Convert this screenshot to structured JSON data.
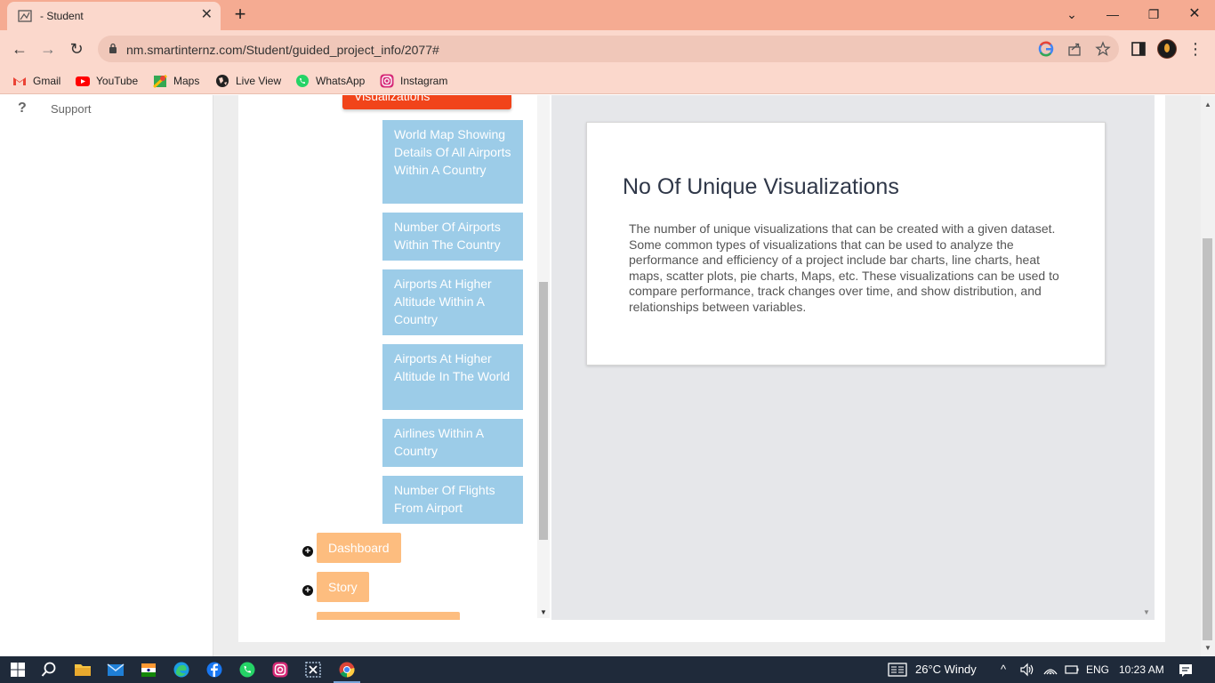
{
  "browser": {
    "tab_title": "- Student",
    "tab_close": "✕",
    "new_tab": "+",
    "url": "nm.smartinternz.com/Student/guided_project_info/2077#",
    "window_controls": {
      "minimize": "—",
      "restore": "❐",
      "close": "✕",
      "dropdown": "⌄"
    },
    "nav": {
      "back": "←",
      "forward": "→",
      "reload": "↻"
    },
    "toolbar_icons": [
      "google-icon",
      "share-icon",
      "star-icon",
      "side-panel-icon",
      "profile-avatar",
      "more-menu-icon"
    ],
    "more_menu": "⋮"
  },
  "bookmarks": [
    {
      "label": "Gmail",
      "icon": "gmail-icon",
      "color": "#ea4335"
    },
    {
      "label": "YouTube",
      "icon": "youtube-icon",
      "color": "#ff0000"
    },
    {
      "label": "Maps",
      "icon": "maps-icon",
      "color": "#34a853"
    },
    {
      "label": "Live View",
      "icon": "globe-icon",
      "color": "#222222"
    },
    {
      "label": "WhatsApp",
      "icon": "whatsapp-icon",
      "color": "#25d366"
    },
    {
      "label": "Instagram",
      "icon": "instagram-icon",
      "color": "#d62976"
    }
  ],
  "sidebar": {
    "support_icon": "?",
    "support_label": "Support"
  },
  "tree": {
    "active_item": "Visualizations",
    "sub_items": [
      "World Map Showing Details Of All Airports Within A Country",
      "Number Of Airports Within The Country",
      "Airports At Higher Altitude Within A Country",
      "Airports At Higher Altitude In The World",
      "Airlines Within A Country",
      "Number Of Flights From Airport"
    ],
    "sections": [
      {
        "label": "Dashboard"
      },
      {
        "label": "Story"
      }
    ],
    "plus_symbol": "+",
    "scroll_down": "▼",
    "colors": {
      "active": "#f1441a",
      "sub_item": "#9ccce8",
      "section": "#fdbd7f"
    }
  },
  "content": {
    "title": "No Of Unique Visualizations",
    "description": "The number of unique visualizations that can be created with a given dataset. Some common types of visualizations that can be used to analyze the performance and efficiency of a project include bar charts, line charts, heat maps, scatter plots, pie charts, Maps, etc. These visualizations can be used to compare performance, track changes over time, and show distribution, and relationships between variables."
  },
  "scrollbar": {
    "up": "▲",
    "down": "▼"
  },
  "taskbar": {
    "apps": [
      "windows-start-icon",
      "search-icon",
      "file-explorer-icon",
      "mail-icon",
      "flag-app-icon",
      "edge-icon",
      "facebook-icon",
      "whatsapp-icon",
      "instagram-icon",
      "snip-icon",
      "chrome-icon"
    ],
    "weather": "26°C  Windy",
    "language": "ENG",
    "time": "10:23 AM",
    "tray_chevron": "^"
  }
}
